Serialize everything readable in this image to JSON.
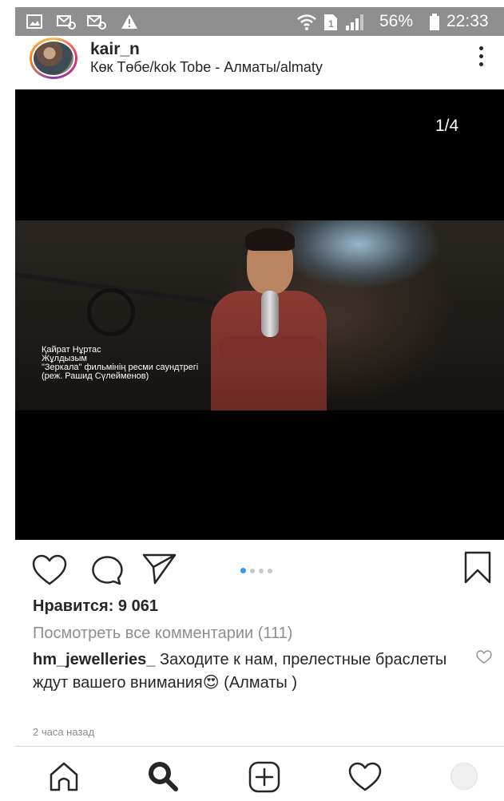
{
  "status_bar": {
    "battery": "56%",
    "time": "22:33",
    "icons": [
      "gallery-icon",
      "message-settings-icon",
      "message-settings-icon",
      "warning-icon",
      "wifi-icon",
      "sim-icon",
      "signal-icon",
      "battery-icon"
    ]
  },
  "post": {
    "username": "kair_n",
    "location": "Көк Төбе/kok Tobe - Алматы/almaty",
    "counter": "1/4",
    "caption_lines": [
      "Қайрат Нұртас",
      "Жұлдызым",
      "\"Зеркала\" фильмінің ресми саундтрегі",
      "(реж. Рашид Сүлейменов)"
    ],
    "likes": "Нравится: 9 061",
    "view_comments": "Посмотреть все комментарии (111)",
    "comment": {
      "author": "hm_jewelleries_",
      "text": "Заходите к нам, прелестные браслеты  ждут вашего внимания😍 (Алматы )"
    },
    "time_ago": "2 часа назад",
    "carousel": {
      "total": 4,
      "active_index": 0
    }
  },
  "colors": {
    "accent": "#3897f0",
    "text": "#262626",
    "muted": "#8e8e8e",
    "status_bar": "#8f8f8f"
  },
  "bottom_nav": [
    "home-icon",
    "search-icon",
    "add-post-icon",
    "activity-heart-icon",
    "profile-avatar"
  ]
}
